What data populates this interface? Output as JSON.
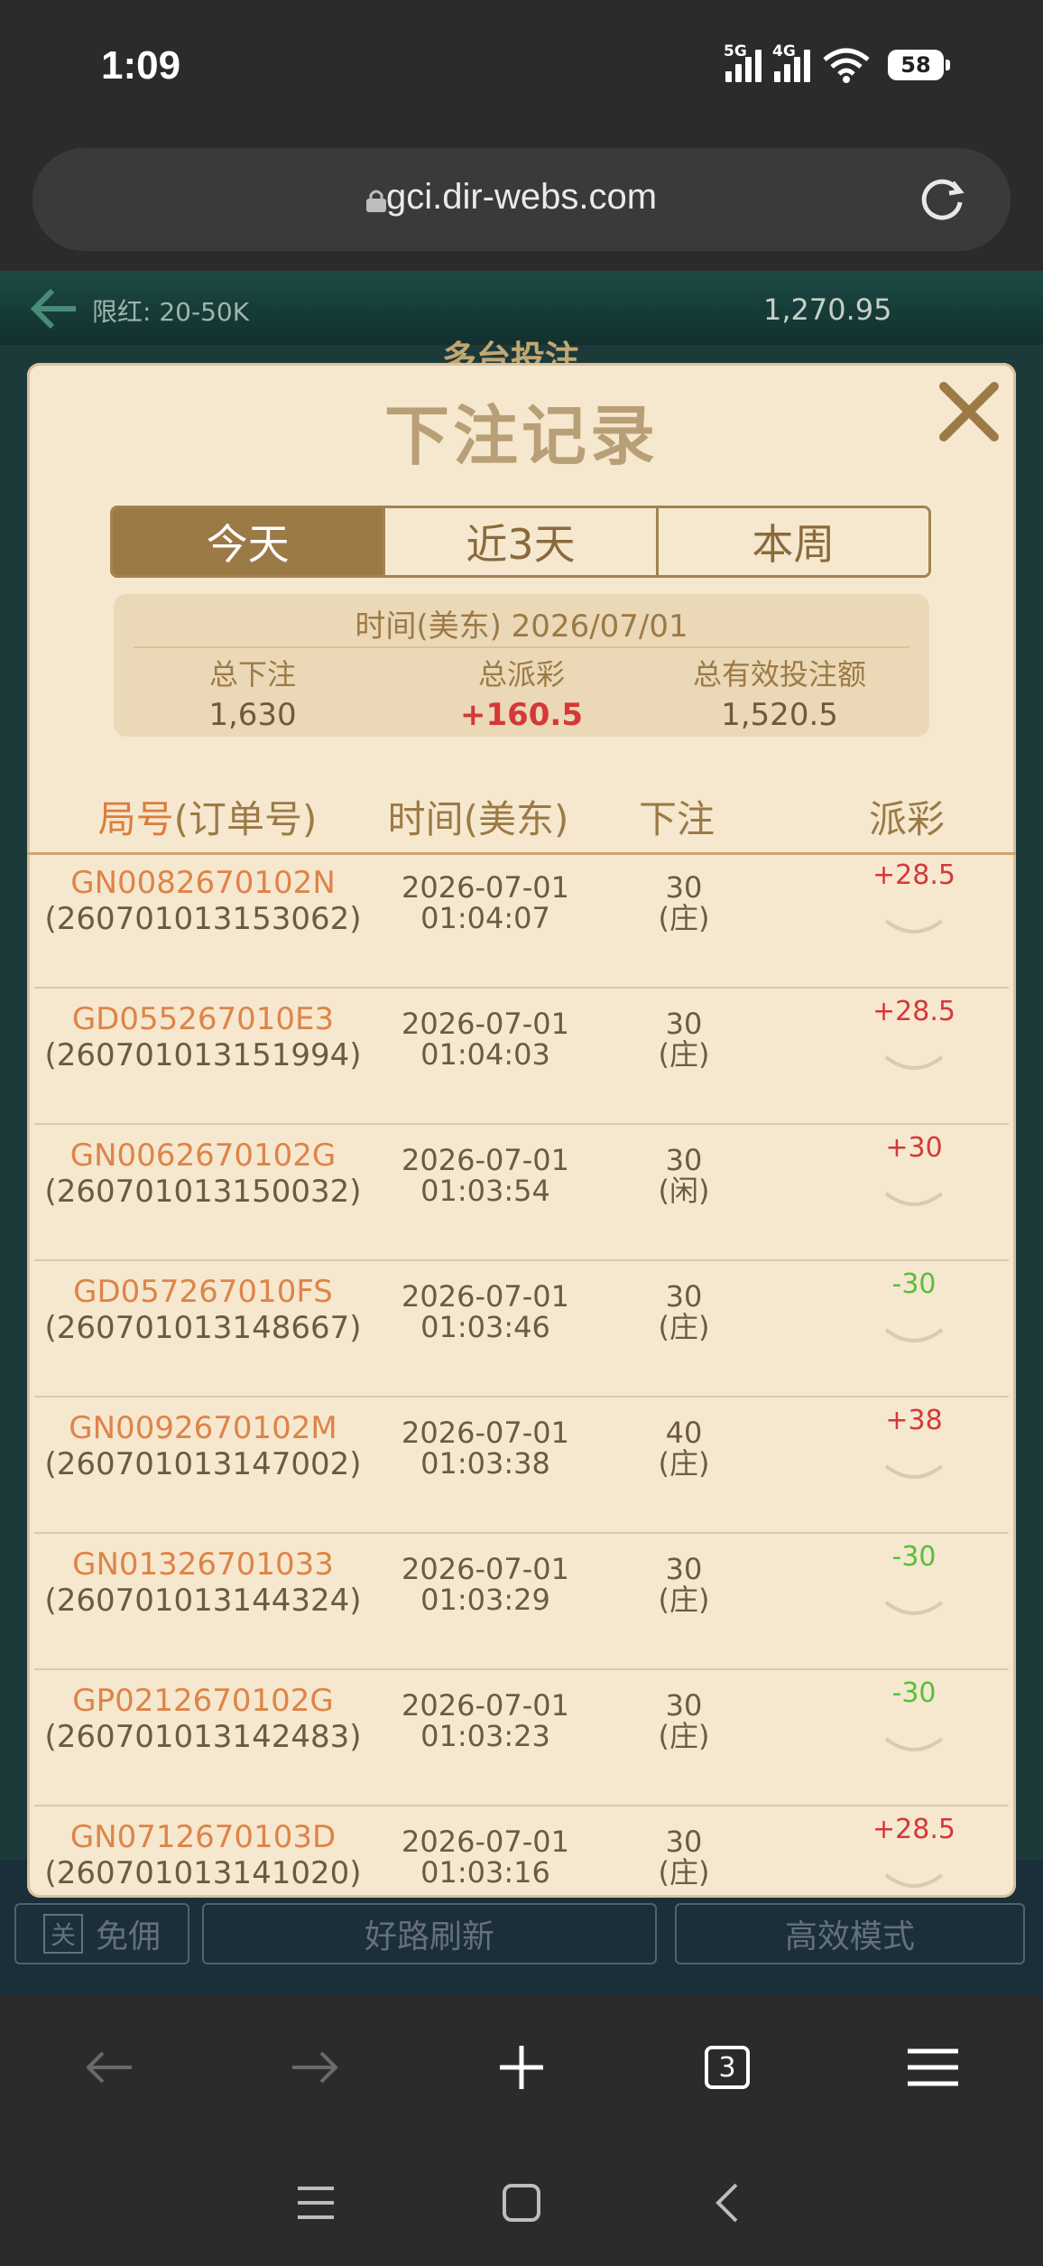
{
  "status": {
    "time": "1:09",
    "signal1": "5G",
    "signal2": "4G",
    "battery": "58"
  },
  "browser": {
    "url": "gci.dir-webs.com",
    "tab_count": "3"
  },
  "game": {
    "limit": "限红: 20-50K",
    "balance": "1,270.95",
    "title": "多台投注",
    "bottom_buttons": {
      "toggle": "关",
      "free": "免佣",
      "refresh": "好路刷新",
      "mode": "高效模式"
    }
  },
  "modal": {
    "title": "下注记录",
    "tabs": [
      {
        "label": "今天"
      },
      {
        "label": "近3天"
      },
      {
        "label": "本周"
      }
    ],
    "summary": {
      "time": "时间(美东) 2026/07/01",
      "total_bet_label": "总下注",
      "total_bet": "1,630",
      "total_payout_label": "总派彩",
      "total_payout": "+160.5",
      "total_valid_label": "总有效投注额",
      "total_valid": "1,520.5"
    },
    "headers": {
      "id_part1": "局号",
      "id_part2": "(订单号)",
      "time": "时间(美东)",
      "bet": "下注",
      "payout": "派彩"
    },
    "rows": [
      {
        "code": "GN0082670102N",
        "order": "(260701013153062)",
        "date": "2026-07-01",
        "clock": "01:04:07",
        "amount": "30",
        "side": "(庄)",
        "payout": "+28.5"
      },
      {
        "code": "GD055267010E3",
        "order": "(260701013151994)",
        "date": "2026-07-01",
        "clock": "01:04:03",
        "amount": "30",
        "side": "(庄)",
        "payout": "+28.5"
      },
      {
        "code": "GN0062670102G",
        "order": "(260701013150032)",
        "date": "2026-07-01",
        "clock": "01:03:54",
        "amount": "30",
        "side": "(闲)",
        "payout": "+30"
      },
      {
        "code": "GD057267010FS",
        "order": "(260701013148667)",
        "date": "2026-07-01",
        "clock": "01:03:46",
        "amount": "30",
        "side": "(庄)",
        "payout": "-30"
      },
      {
        "code": "GN0092670102M",
        "order": "(260701013147002)",
        "date": "2026-07-01",
        "clock": "01:03:38",
        "amount": "40",
        "side": "(庄)",
        "payout": "+38"
      },
      {
        "code": "GN01326701033",
        "order": "(260701013144324)",
        "date": "2026-07-01",
        "clock": "01:03:29",
        "amount": "30",
        "side": "(庄)",
        "payout": "-30"
      },
      {
        "code": "GP0212670102G",
        "order": "(260701013142483)",
        "date": "2026-07-01",
        "clock": "01:03:23",
        "amount": "30",
        "side": "(庄)",
        "payout": "-30"
      },
      {
        "code": "GN0712670103D",
        "order": "(260701013141020)",
        "date": "2026-07-01",
        "clock": "01:03:16",
        "amount": "30",
        "side": "(庄)",
        "payout": "+28.5"
      }
    ]
  },
  "colors": {
    "modal_bg": "#f6e8cf",
    "accent": "#9c7a45",
    "positive": "#d53838",
    "negative": "#57c03a",
    "code": "#de8448"
  }
}
